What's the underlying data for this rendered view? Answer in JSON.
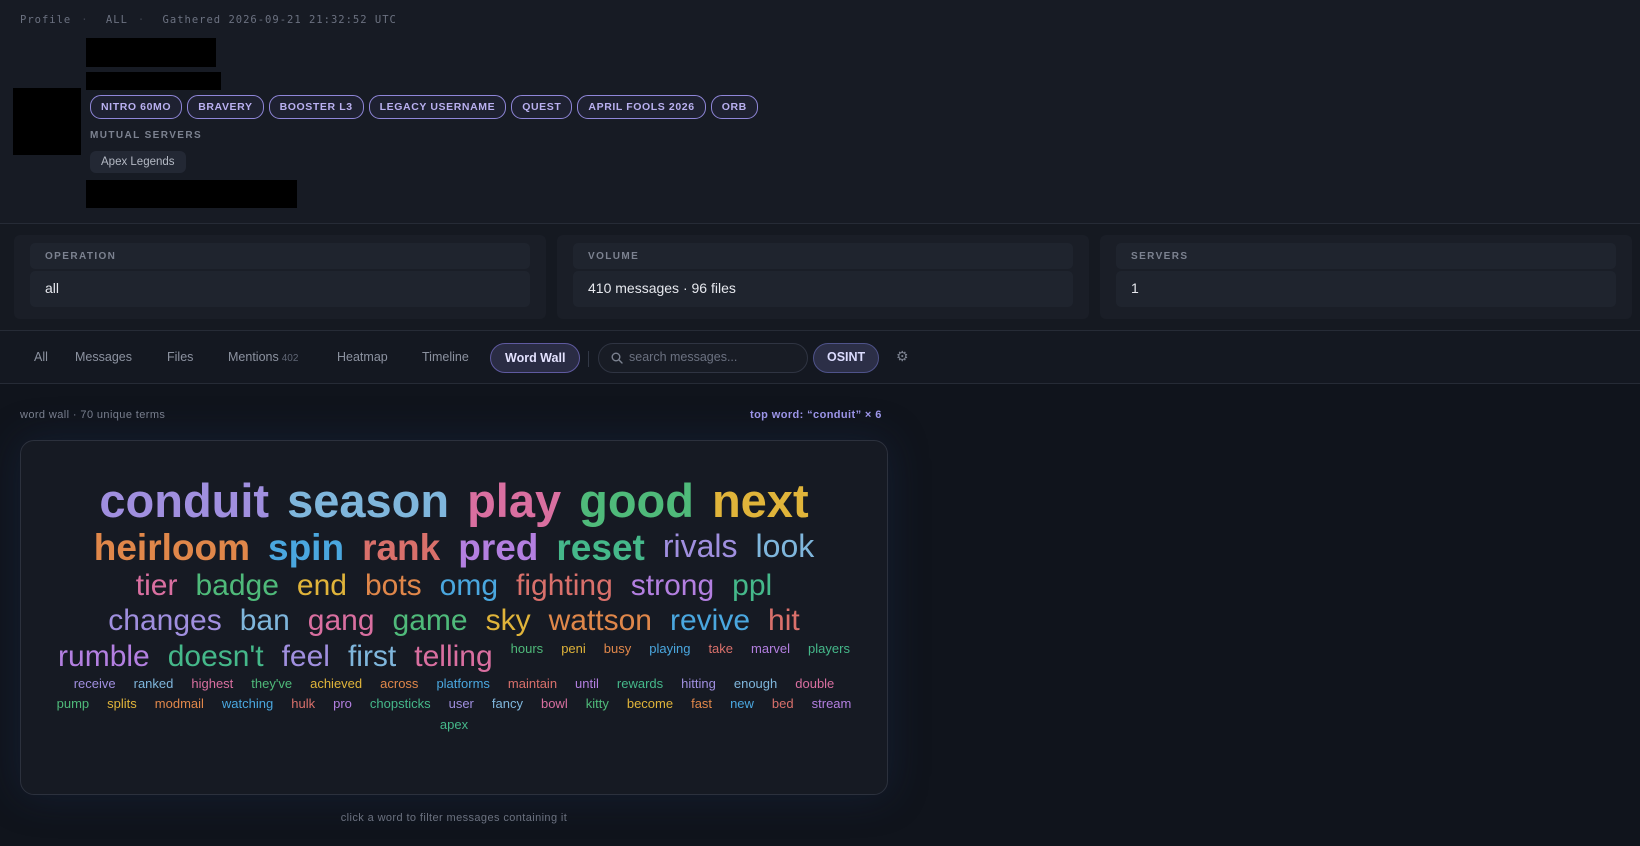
{
  "header": {
    "crumbs": [
      "Profile",
      "ALL",
      "Gathered 2026-09-21 21:32:52 UTC"
    ]
  },
  "profile": {
    "badges": [
      "NITRO 60MO",
      "BRAVERY",
      "BOOSTER L3",
      "LEGACY USERNAME",
      "QUEST",
      "APRIL FOOLS 2026",
      "ORB"
    ],
    "mutual_label": "MUTUAL SERVERS",
    "servers": [
      "Apex Legends"
    ]
  },
  "stats": [
    {
      "label": "OPERATION",
      "value": "all"
    },
    {
      "label": "VOLUME",
      "value": "410 messages · 96 files"
    },
    {
      "label": "SERVERS",
      "value": "1"
    }
  ],
  "tabs": [
    {
      "label": "All"
    },
    {
      "label": "Messages"
    },
    {
      "label": "Files"
    },
    {
      "label": "Mentions",
      "count": "402"
    },
    {
      "label": "Heatmap"
    },
    {
      "label": "Timeline"
    },
    {
      "label": "Word Wall",
      "active": true
    }
  ],
  "search": {
    "placeholder": "search messages..."
  },
  "osint_label": "OSINT",
  "gear_icon": "gear-icon",
  "wordwall": {
    "meta": "word wall · 70 unique terms",
    "top": "top word: “conduit” × 6",
    "hint": "click a word to filter messages containing it",
    "words": [
      {
        "t": "conduit",
        "c": "#a08fdf",
        "s": 5
      },
      {
        "t": "season",
        "c": "#7fb6dc",
        "s": 5
      },
      {
        "t": "play",
        "c": "#d96fa0",
        "s": 5
      },
      {
        "t": "good",
        "c": "#4fba7a",
        "s": 5
      },
      {
        "t": "next",
        "c": "#e0b43a",
        "s": 5
      },
      {
        "t": "heirloom",
        "c": "#e0874a",
        "s": 4
      },
      {
        "t": "spin",
        "c": "#4aa7df",
        "s": 4
      },
      {
        "t": "rank",
        "c": "#d9706b",
        "s": 4
      },
      {
        "t": "pred",
        "c": "#b37fe0",
        "s": 4
      },
      {
        "t": "reset",
        "c": "#45b88a",
        "s": 4
      },
      {
        "t": "rivals",
        "c": "#a08fdf",
        "s": 3
      },
      {
        "t": "look",
        "c": "#7fb6dc",
        "s": 3
      },
      {
        "t": "tier",
        "c": "#d96fa0",
        "s": 2
      },
      {
        "t": "badge",
        "c": "#4fba7a",
        "s": 2
      },
      {
        "t": "end",
        "c": "#e0b43a",
        "s": 2
      },
      {
        "t": "bots",
        "c": "#e0874a",
        "s": 2
      },
      {
        "t": "omg",
        "c": "#4aa7df",
        "s": 2
      },
      {
        "t": "fighting",
        "c": "#d9706b",
        "s": 2
      },
      {
        "t": "strong",
        "c": "#b37fe0",
        "s": 2
      },
      {
        "t": "ppl",
        "c": "#45b88a",
        "s": 2
      },
      {
        "t": "changes",
        "c": "#a08fdf",
        "s": 2
      },
      {
        "t": "ban",
        "c": "#7fb6dc",
        "s": 2
      },
      {
        "t": "gang",
        "c": "#d96fa0",
        "s": 2
      },
      {
        "t": "game",
        "c": "#4fba7a",
        "s": 2
      },
      {
        "t": "sky",
        "c": "#e0b43a",
        "s": 2
      },
      {
        "t": "wattson",
        "c": "#e0874a",
        "s": 2
      },
      {
        "t": "revive",
        "c": "#4aa7df",
        "s": 2
      },
      {
        "t": "hit",
        "c": "#d9706b",
        "s": 2
      },
      {
        "t": "rumble",
        "c": "#b37fe0",
        "s": 2
      },
      {
        "t": "doesn't",
        "c": "#45b88a",
        "s": 2
      },
      {
        "t": "feel",
        "c": "#a08fdf",
        "s": 2
      },
      {
        "t": "first",
        "c": "#7fb6dc",
        "s": 2
      },
      {
        "t": "telling",
        "c": "#d96fa0",
        "s": 2
      },
      {
        "t": "hours",
        "c": "#4fba7a",
        "s": 1
      },
      {
        "t": "peni",
        "c": "#e0b43a",
        "s": 1
      },
      {
        "t": "busy",
        "c": "#e0874a",
        "s": 1
      },
      {
        "t": "playing",
        "c": "#4aa7df",
        "s": 1
      },
      {
        "t": "take",
        "c": "#d9706b",
        "s": 1
      },
      {
        "t": "marvel",
        "c": "#b37fe0",
        "s": 1
      },
      {
        "t": "players",
        "c": "#45b88a",
        "s": 1
      },
      {
        "t": "receive",
        "c": "#a08fdf",
        "s": 1
      },
      {
        "t": "ranked",
        "c": "#7fb6dc",
        "s": 1
      },
      {
        "t": "highest",
        "c": "#d96fa0",
        "s": 1
      },
      {
        "t": "they've",
        "c": "#4fba7a",
        "s": 1
      },
      {
        "t": "achieved",
        "c": "#e0b43a",
        "s": 1
      },
      {
        "t": "across",
        "c": "#e0874a",
        "s": 1
      },
      {
        "t": "platforms",
        "c": "#4aa7df",
        "s": 1
      },
      {
        "t": "maintain",
        "c": "#d9706b",
        "s": 1
      },
      {
        "t": "until",
        "c": "#b37fe0",
        "s": 1
      },
      {
        "t": "rewards",
        "c": "#45b88a",
        "s": 1
      },
      {
        "t": "hitting",
        "c": "#a08fdf",
        "s": 1
      },
      {
        "t": "enough",
        "c": "#7fb6dc",
        "s": 1
      },
      {
        "t": "double",
        "c": "#d96fa0",
        "s": 1
      },
      {
        "t": "pump",
        "c": "#4fba7a",
        "s": 1
      },
      {
        "t": "splits",
        "c": "#e0b43a",
        "s": 1
      },
      {
        "t": "modmail",
        "c": "#e0874a",
        "s": 1
      },
      {
        "t": "watching",
        "c": "#4aa7df",
        "s": 1
      },
      {
        "t": "hulk",
        "c": "#d9706b",
        "s": 1
      },
      {
        "t": "pro",
        "c": "#b37fe0",
        "s": 1
      },
      {
        "t": "chopsticks",
        "c": "#45b88a",
        "s": 1
      },
      {
        "t": "user",
        "c": "#a08fdf",
        "s": 1
      },
      {
        "t": "fancy",
        "c": "#7fb6dc",
        "s": 1
      },
      {
        "t": "bowl",
        "c": "#d96fa0",
        "s": 1
      },
      {
        "t": "kitty",
        "c": "#4fba7a",
        "s": 1
      },
      {
        "t": "become",
        "c": "#e0b43a",
        "s": 1
      },
      {
        "t": "fast",
        "c": "#e0874a",
        "s": 1
      },
      {
        "t": "new",
        "c": "#4aa7df",
        "s": 1
      },
      {
        "t": "bed",
        "c": "#d9706b",
        "s": 1
      },
      {
        "t": "stream",
        "c": "#b37fe0",
        "s": 1
      },
      {
        "t": "apex",
        "c": "#45b88a",
        "s": 1
      }
    ]
  }
}
